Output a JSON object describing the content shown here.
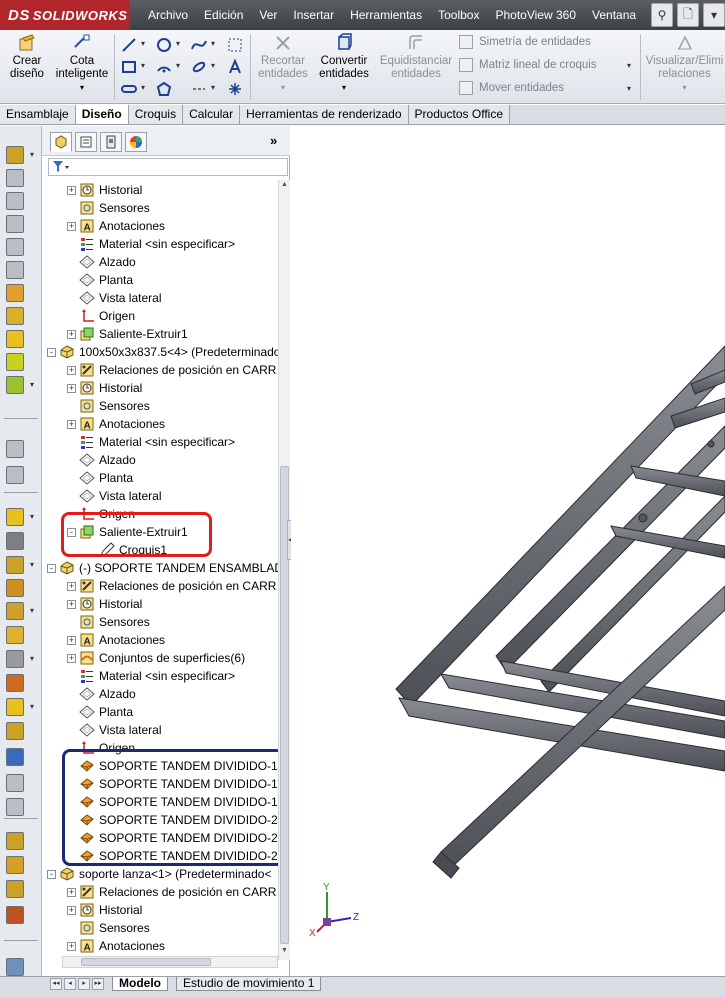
{
  "app": {
    "logo_brand": "DS",
    "logo_name": "SOLIDWORKS",
    "menu": [
      "Archivo",
      "Edición",
      "Ver",
      "Insertar",
      "Herramientas",
      "Toolbox",
      "PhotoView 360",
      "Ventana",
      "?"
    ]
  },
  "ribbon": {
    "crear_diseno": "Crear diseño",
    "cota_inteligente": "Cota inteligente",
    "recortar_entidades": "Recortar entidades",
    "convertir_entidades": "Convertir entidades",
    "equidistanciar_entidades": "Equidistanciar entidades",
    "simetria": "Simetría de entidades",
    "matriz": "Matriz lineal de croquis",
    "mover": "Mover entidades",
    "visualizar": "Visualizar/Elimi relaciones"
  },
  "tabs": [
    "Ensamblaje",
    "Diseño",
    "Croquis",
    "Calcular",
    "Herramientas de renderizado",
    "Productos Office"
  ],
  "active_tab": "Diseño",
  "tree": [
    {
      "text": "Historial",
      "depth": 1,
      "pm": "+",
      "icon": "history-icon"
    },
    {
      "text": "Sensores",
      "depth": 1,
      "pm": "",
      "icon": "sensor-icon"
    },
    {
      "text": "Anotaciones",
      "depth": 1,
      "pm": "+",
      "icon": "annotation-icon"
    },
    {
      "text": "Material <sin especificar>",
      "depth": 1,
      "pm": "",
      "icon": "material-icon"
    },
    {
      "text": "Alzado",
      "depth": 1,
      "pm": "",
      "icon": "plane-icon"
    },
    {
      "text": "Planta",
      "depth": 1,
      "pm": "",
      "icon": "plane-icon"
    },
    {
      "text": "Vista lateral",
      "depth": 1,
      "pm": "",
      "icon": "plane-icon"
    },
    {
      "text": "Origen",
      "depth": 1,
      "pm": "",
      "icon": "origin-icon"
    },
    {
      "text": "Saliente-Extruir1",
      "depth": 1,
      "pm": "+",
      "icon": "extrude-icon"
    },
    {
      "text": "100x50x3x837.5<4> (Predeterminado",
      "depth": 0,
      "pm": "-",
      "icon": "part-icon"
    },
    {
      "text": "Relaciones de posición en CARR",
      "depth": 1,
      "pm": "+",
      "icon": "mate-icon"
    },
    {
      "text": "Historial",
      "depth": 1,
      "pm": "+",
      "icon": "history-icon"
    },
    {
      "text": "Sensores",
      "depth": 1,
      "pm": "",
      "icon": "sensor-icon"
    },
    {
      "text": "Anotaciones",
      "depth": 1,
      "pm": "+",
      "icon": "annotation-icon"
    },
    {
      "text": "Material <sin especificar>",
      "depth": 1,
      "pm": "",
      "icon": "material-icon"
    },
    {
      "text": "Alzado",
      "depth": 1,
      "pm": "",
      "icon": "plane-icon"
    },
    {
      "text": "Planta",
      "depth": 1,
      "pm": "",
      "icon": "plane-icon"
    },
    {
      "text": "Vista lateral",
      "depth": 1,
      "pm": "",
      "icon": "plane-icon"
    },
    {
      "text": "Origen",
      "depth": 1,
      "pm": "",
      "icon": "origin-icon"
    },
    {
      "text": "Saliente-Extruir1",
      "depth": 1,
      "pm": "-",
      "icon": "extrude-icon"
    },
    {
      "text": "Croquis1",
      "depth": 2,
      "pm": "",
      "icon": "sketch-icon"
    },
    {
      "text": "(-) SOPORTE TANDEM ENSAMBLAD",
      "depth": 0,
      "pm": "-",
      "icon": "part-icon"
    },
    {
      "text": "Relaciones de posición en CARR",
      "depth": 1,
      "pm": "+",
      "icon": "mate-icon"
    },
    {
      "text": "Historial",
      "depth": 1,
      "pm": "+",
      "icon": "history-icon"
    },
    {
      "text": "Sensores",
      "depth": 1,
      "pm": "",
      "icon": "sensor-icon"
    },
    {
      "text": "Anotaciones",
      "depth": 1,
      "pm": "+",
      "icon": "annotation-icon"
    },
    {
      "text": "Conjuntos de superficies(6)",
      "depth": 1,
      "pm": "+",
      "icon": "surface-set-icon"
    },
    {
      "text": "Material <sin especificar>",
      "depth": 1,
      "pm": "",
      "icon": "material-icon"
    },
    {
      "text": "Alzado",
      "depth": 1,
      "pm": "",
      "icon": "plane-icon"
    },
    {
      "text": "Planta",
      "depth": 1,
      "pm": "",
      "icon": "plane-icon"
    },
    {
      "text": "Vista lateral",
      "depth": 1,
      "pm": "",
      "icon": "plane-icon"
    },
    {
      "text": "Origen",
      "depth": 1,
      "pm": "",
      "icon": "origin-icon"
    },
    {
      "text": "SOPORTE TANDEM DIVIDIDO-1-",
      "depth": 1,
      "pm": "",
      "icon": "body-icon"
    },
    {
      "text": "SOPORTE TANDEM DIVIDIDO-1-",
      "depth": 1,
      "pm": "",
      "icon": "body-icon"
    },
    {
      "text": "SOPORTE TANDEM DIVIDIDO-1-",
      "depth": 1,
      "pm": "",
      "icon": "body-icon"
    },
    {
      "text": "SOPORTE TANDEM DIVIDIDO-2-",
      "depth": 1,
      "pm": "",
      "icon": "body-icon"
    },
    {
      "text": "SOPORTE TANDEM DIVIDIDO-2-",
      "depth": 1,
      "pm": "",
      "icon": "body-icon"
    },
    {
      "text": "SOPORTE TANDEM DIVIDIDO-2-",
      "depth": 1,
      "pm": "",
      "icon": "body-icon"
    },
    {
      "text": "soporte lanza<1> (Predeterminado<",
      "depth": 0,
      "pm": "-",
      "icon": "part-icon"
    },
    {
      "text": "Relaciones de posición en CARR",
      "depth": 1,
      "pm": "+",
      "icon": "mate-icon"
    },
    {
      "text": "Historial",
      "depth": 1,
      "pm": "+",
      "icon": "history-icon"
    },
    {
      "text": "Sensores",
      "depth": 1,
      "pm": "",
      "icon": "sensor-icon"
    },
    {
      "text": "Anotaciones",
      "depth": 1,
      "pm": "+",
      "icon": "annotation-icon"
    }
  ],
  "triad": {
    "x": "X",
    "y": "Y",
    "z": "Z"
  },
  "bottom_tabs": [
    "Modelo",
    "Estudio de movimiento 1"
  ],
  "active_bottom_tab": "Modelo",
  "colors": {
    "brand": "#b1262a",
    "highlight_red": "#e21b1b",
    "highlight_blue": "#1d2a73",
    "model_steel": "#6f7179"
  }
}
